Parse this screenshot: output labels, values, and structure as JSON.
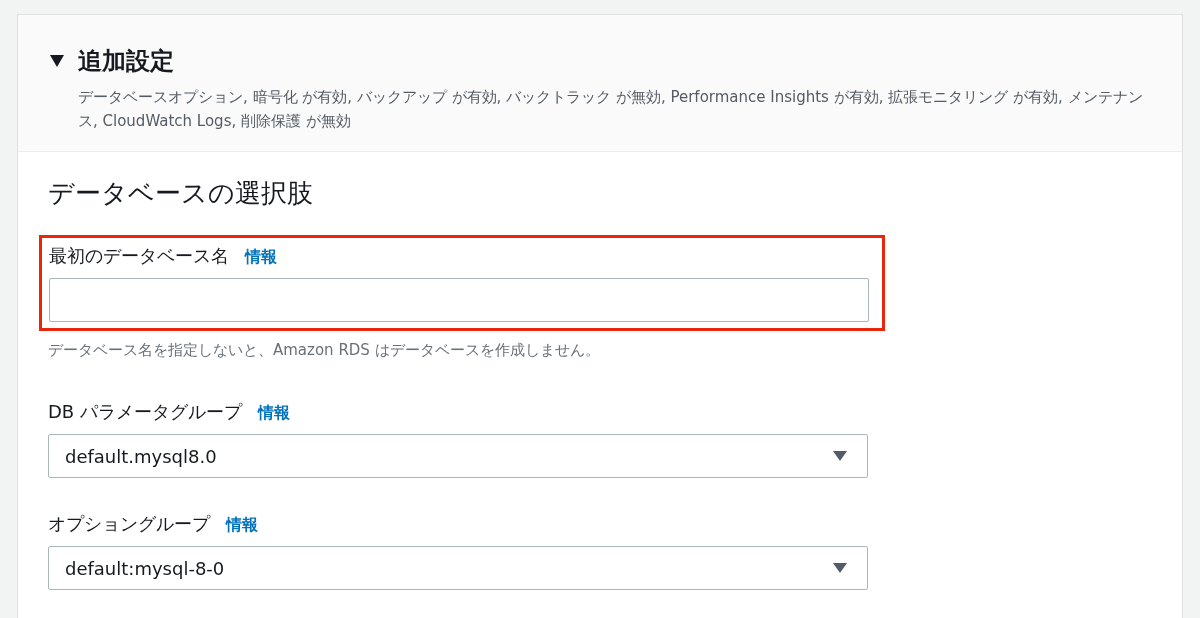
{
  "section": {
    "title": "追加設定",
    "expanded": true,
    "summary": "データベースオプション, 暗号化 が有効, バックアップ が有効, バックトラック が無効, Performance Insights が有効, 拡張モニタリング が有効, メンテナンス, CloudWatch Logs, 削除保護 が無効"
  },
  "group_title": "データベースの選択肢",
  "fields": [
    {
      "kind": "text",
      "label": "最初のデータベース名",
      "info": "情報",
      "highlighted": true,
      "help": "データベース名を指定しないと、Amazon RDS はデータベースを作成しません。"
    },
    {
      "kind": "select",
      "label": "DB パラメータグループ",
      "info": "情報",
      "value": "default.mysql8.0",
      "highlighted": false
    },
    {
      "kind": "select",
      "label": "オプショングループ",
      "info": "情報",
      "value": "default:mysql-8-0",
      "highlighted": false
    }
  ]
}
